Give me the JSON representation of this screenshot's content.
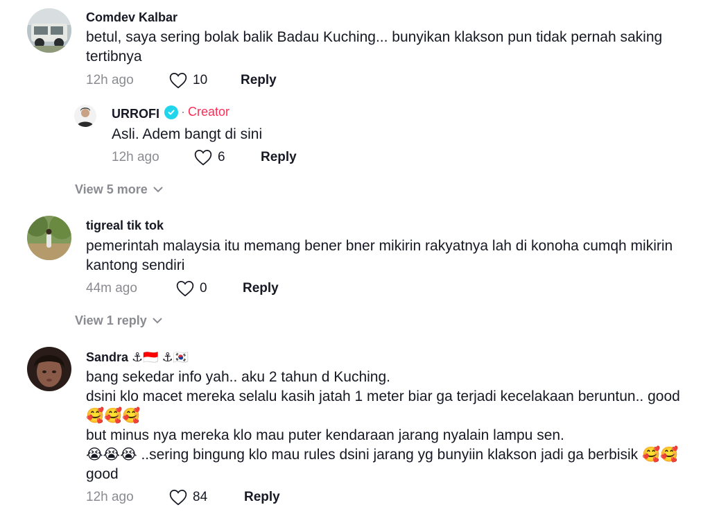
{
  "comments": [
    {
      "username": "Comdev Kalbar",
      "text": "betul, saya sering bolak balik Badau Kuching... bunyikan klakson pun tidak pernah saking\ntertibnya",
      "time": "12h ago",
      "likes": "10",
      "reply_label": "Reply"
    },
    {
      "username": "URROFI",
      "creator_label": "Creator",
      "text": "Asli. Adem bangt di sini",
      "time": "12h ago",
      "likes": "6",
      "reply_label": "Reply"
    },
    {
      "username": "tigreal tik tok",
      "text": "pemerintah malaysia itu memang bener bner mikirin rakyatnya lah di konoha cumqh mikirin\nkantong sendiri",
      "time": "44m ago",
      "likes": "0",
      "reply_label": "Reply"
    },
    {
      "username": "Sandra ⚓🇮🇩 ⚓🇰🇷",
      "text": "bang sekedar info yah.. aku 2 tahun d Kuching.\ndsini klo macet mereka selalu kasih jatah 1 meter biar ga terjadi kecelakaan beruntun.. good\n🥰🥰🥰\nbut minus nya mereka klo mau puter kendaraan jarang nyalain lampu sen.\n😭😭😭 ..sering bingung klo mau rules dsini jarang yg bunyiin klakson jadi ga berbisik 🥰🥰\ngood",
      "time": "12h ago",
      "likes": "84",
      "reply_label": "Reply"
    }
  ],
  "view_more": {
    "label": "View 5 more"
  },
  "view_reply": {
    "label": "View 1 reply"
  },
  "colors": {
    "creator": "#fe2c55",
    "verified": "#20d5ec",
    "muted": "#8a8b91"
  },
  "icons": [
    "heart-outline-icon",
    "chevron-down-icon",
    "verified-check-icon"
  ]
}
